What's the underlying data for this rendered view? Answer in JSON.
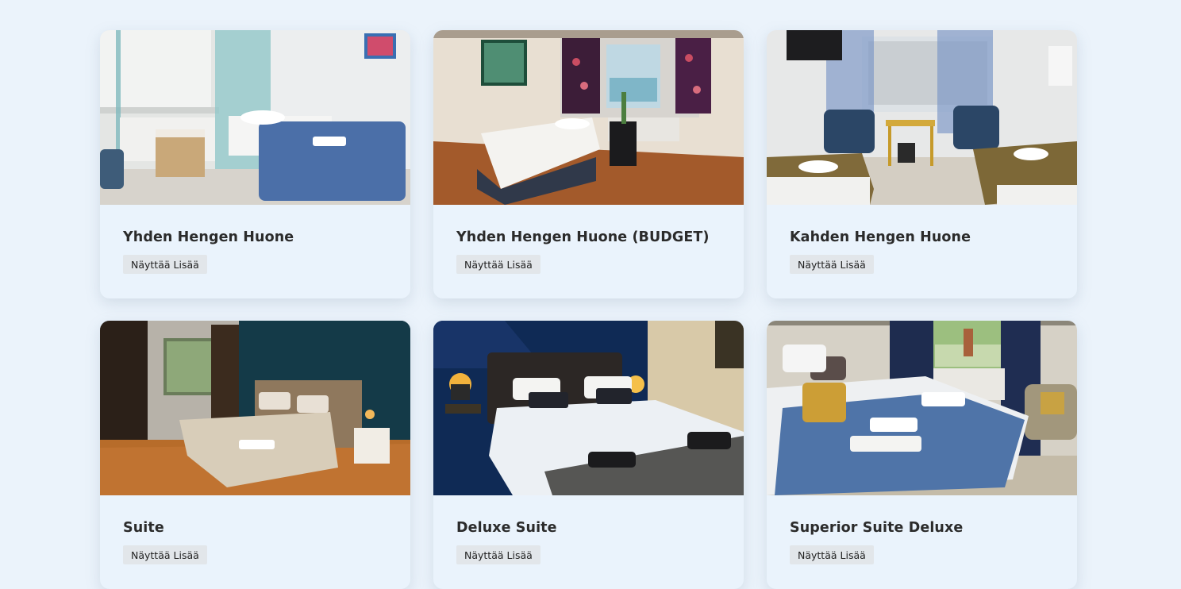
{
  "rooms": [
    {
      "title": "Yhden Hengen Huone",
      "button_label": "Näyttää Lisää",
      "image": "single-room-photo"
    },
    {
      "title": "Yhden Hengen Huone (BUDGET)",
      "button_label": "Näyttää Lisää",
      "image": "budget-single-room-photo"
    },
    {
      "title": "Kahden Hengen Huone",
      "button_label": "Näyttää Lisää",
      "image": "double-room-photo"
    },
    {
      "title": "Suite",
      "button_label": "Näyttää Lisää",
      "image": "suite-photo"
    },
    {
      "title": "Deluxe Suite",
      "button_label": "Näyttää Lisää",
      "image": "deluxe-suite-photo"
    },
    {
      "title": "Superior Suite Deluxe",
      "button_label": "Näyttää Lisää",
      "image": "superior-suite-deluxe-photo"
    }
  ]
}
